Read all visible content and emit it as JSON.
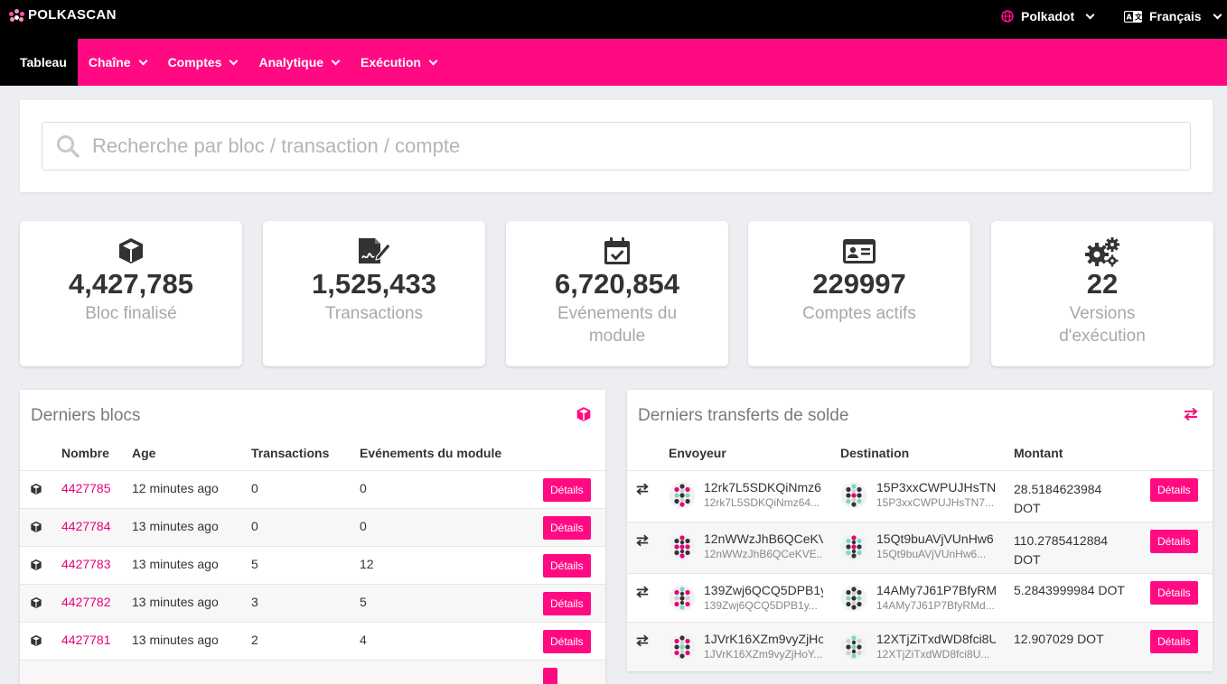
{
  "app": {
    "name": "POLKASCAN"
  },
  "topbar": {
    "network": "Polkadot",
    "language": "Français"
  },
  "nav": {
    "items": [
      {
        "label": "Tableau",
        "active": true,
        "dropdown": false
      },
      {
        "label": "Chaîne",
        "active": false,
        "dropdown": true
      },
      {
        "label": "Comptes",
        "active": false,
        "dropdown": true
      },
      {
        "label": "Analytique",
        "active": false,
        "dropdown": true
      },
      {
        "label": "Exécution",
        "active": false,
        "dropdown": true
      }
    ]
  },
  "search": {
    "placeholder": "Recherche par bloc / transaction / compte",
    "value": ""
  },
  "stats": [
    {
      "icon": "cube-icon",
      "value": "4,427,785",
      "label": "Bloc finalisé"
    },
    {
      "icon": "signature-icon",
      "value": "1,525,433",
      "label": "Transactions"
    },
    {
      "icon": "calendar-check-icon",
      "value": "6,720,854",
      "label": "Evénements du module"
    },
    {
      "icon": "id-card-icon",
      "value": "229997",
      "label": "Comptes actifs"
    },
    {
      "icon": "cogs-icon",
      "value": "22",
      "label": "Versions d'exécution"
    }
  ],
  "blocks": {
    "title": "Derniers blocs",
    "columns": [
      "Nombre",
      "Age",
      "Transactions",
      "Evénements du module"
    ],
    "button_label": "Détails",
    "rows": [
      {
        "number": "4427785",
        "age": "12 minutes ago",
        "transactions": "0",
        "events": "0"
      },
      {
        "number": "4427784",
        "age": "13 minutes ago",
        "transactions": "0",
        "events": "0"
      },
      {
        "number": "4427783",
        "age": "13 minutes ago",
        "transactions": "5",
        "events": "12"
      },
      {
        "number": "4427782",
        "age": "13 minutes ago",
        "transactions": "3",
        "events": "5"
      },
      {
        "number": "4427781",
        "age": "13 minutes ago",
        "transactions": "2",
        "events": "4"
      }
    ]
  },
  "transfers": {
    "title": "Derniers transferts de solde",
    "columns": [
      "Envoyeur",
      "Destination",
      "Montant"
    ],
    "button_label": "Détails",
    "rows": [
      {
        "sender": "12rk7L5SDKQiNmz6",
        "sender_short": "12rk7L5SDKQiNmz64...",
        "dest": "15P3xxCWPUJHsTN7",
        "dest_short": "15P3xxCWPUJHsTN7...",
        "amount": "28.5184623984 DOT"
      },
      {
        "sender": "12nWWzJhB6QCeKV",
        "sender_short": "12nWWzJhB6QCeKVE...",
        "dest": "15Qt9buAVjVUnHw6",
        "dest_short": "15Qt9buAVjVUnHw6...",
        "amount": "110.2785412884 DOT"
      },
      {
        "sender": "139Zwj6QCQ5DPB1y",
        "sender_short": "139Zwj6QCQ5DPB1y...",
        "dest": "14AMy7J61P7BfyRM",
        "dest_short": "14AMy7J61P7BfyRMd...",
        "amount": "5.2843999984 DOT"
      },
      {
        "sender": "1JVrK16XZm9vyZjHo",
        "sender_short": "1JVrK16XZm9vyZjHoY...",
        "dest": "12XTjZiTxdWD8fci8U",
        "dest_short": "12XTjZiTxdWD8fci8U...",
        "amount": "12.907029 DOT"
      }
    ]
  },
  "colors": {
    "accent": "#ff0a82",
    "link": "#e6007a",
    "topbar": "#000000"
  }
}
